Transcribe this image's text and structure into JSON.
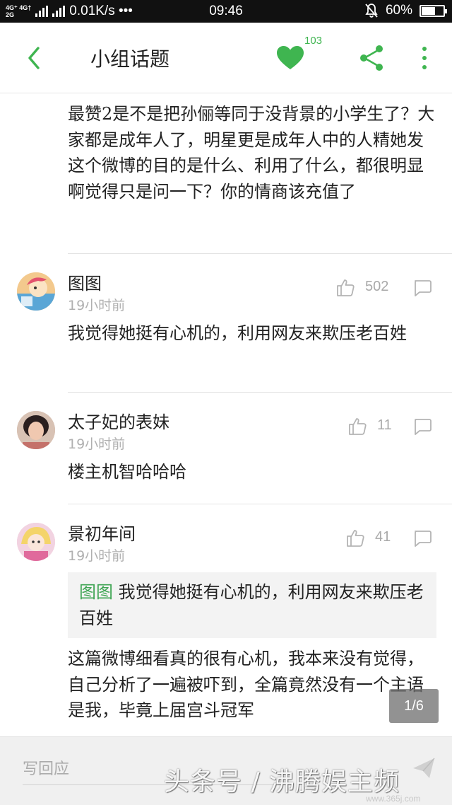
{
  "status_bar": {
    "network_top": "4G⁺ 4G†",
    "network_bottom": "2G",
    "speed": "0.01K/s •••",
    "time": "09:46",
    "battery": "60%",
    "battery_level": 0.6
  },
  "header": {
    "title": "小组话题",
    "like_count": "103",
    "accent_color": "#3fb550"
  },
  "post": {
    "text": "最赞2是不是把孙俪等同于没背景的小学生了？大家都是成年人了，明星更是成年人中的人精她发这个微博的目的是什么、利用了什么，都很明显啊觉得只是问一下？你的情商该充值了"
  },
  "comments": [
    {
      "user": "图图",
      "time": "19小时前",
      "likes": "502",
      "text": "我觉得她挺有心机的，利用网友来欺压老百姓",
      "avatar_icon": "cartoon-avatar-icon"
    },
    {
      "user": "太子妃的表妹",
      "time": "19小时前",
      "likes": "11",
      "text": "楼主机智哈哈哈",
      "avatar_icon": "photo-avatar-icon"
    },
    {
      "user": "景初年间",
      "time": "19小时前",
      "likes": "41",
      "quote_author": "图图",
      "quote_text": "我觉得她挺有心机的，利用网友来欺压老百姓",
      "text": "这篇微博细看真的很有心机，我本来没有觉得，自己分析了一遍被吓到，全篇竟然没有一个主语是我，毕竟上届宫斗冠军",
      "avatar_icon": "anime-avatar-icon"
    }
  ],
  "pager": "1/6",
  "bottom_bar": {
    "reply_placeholder": "写回应",
    "watermark": "头条号 / 沸腾娱主频",
    "watermark_url": "www.365j.com"
  }
}
